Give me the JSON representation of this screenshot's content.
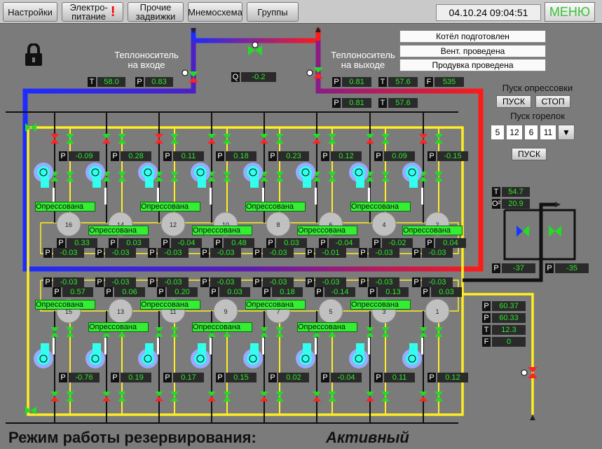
{
  "toolbar": {
    "buttons": [
      {
        "label": "Настройки"
      },
      {
        "line1": "Электро-",
        "line2": "питание",
        "alert": "!"
      },
      {
        "line1": "Прочие",
        "line2": "задвижки"
      },
      {
        "label": "Мнемосхема"
      },
      {
        "label": "Группы"
      }
    ],
    "datetime": "04.10.24 09:04:51",
    "menu_label": "МЕНЮ"
  },
  "status": [
    "Котёл подготовлен",
    "Вент. проведена",
    "Продувка проведена"
  ],
  "inlet": {
    "line1": "Теплоноситель",
    "line2": "на входе",
    "t_label": "T",
    "t": "58.0",
    "p_label": "P",
    "p": "0.83"
  },
  "outlet": {
    "line1": "Теплоноситель",
    "line2": "на выходе",
    "r1": [
      [
        "P",
        "0.81"
      ],
      [
        "T",
        "57.6"
      ],
      [
        "F",
        "535"
      ]
    ],
    "r2": [
      [
        "P",
        "0.81"
      ],
      [
        "T",
        "57.6"
      ]
    ]
  },
  "flow": {
    "label": "Q",
    "value": "-0.2"
  },
  "pressure_test": {
    "title": "Пуск опрессовки",
    "start": "ПУСК",
    "stop": "СТОП"
  },
  "burner_start": {
    "title": "Пуск горелок",
    "numbers": [
      "5",
      "12",
      "6",
      "11"
    ],
    "start": "ПУСК"
  },
  "flue": {
    "t_label": "T",
    "t": "54.7",
    "o2_label": "O²",
    "o2": "20.9",
    "p1_label": "P",
    "p1": "-37",
    "p2_label": "P",
    "p2": "-35"
  },
  "side_readings": [
    [
      "P",
      "60.37"
    ],
    [
      "P",
      "60.33"
    ],
    [
      "T",
      "12.3"
    ],
    [
      "F",
      "0"
    ]
  ],
  "pressed_label": "Опрессована",
  "upper": {
    "top_p": [
      "-0.09",
      "0.28",
      "0.11",
      "0.18",
      "0.23",
      "0.12",
      "0.09",
      "-0.15"
    ],
    "mid_p": [
      "0.33",
      "0.03",
      "-0.04",
      "0.48",
      "0.03",
      "-0.04",
      "-0.02",
      "0.04"
    ],
    "bot_p": [
      "-0.03",
      "-0.03",
      "-0.03",
      "-0.03",
      "-0.03",
      "-0.01",
      "-0.03",
      "-0.03"
    ],
    "burners": [
      "16",
      "14",
      "12",
      "10",
      "8",
      "6",
      "4",
      "2"
    ]
  },
  "lower": {
    "top_p": [
      "-0.03",
      "-0.03",
      "-0.03",
      "-0.03",
      "-0.03",
      "-0.03",
      "-0.03",
      "-0.03"
    ],
    "mid_p": [
      "0.57",
      "0.06",
      "0.20",
      "0.03",
      "0.18",
      "-0.14",
      "0.13",
      "0.03"
    ],
    "bot_p": [
      "-0.76",
      "0.19",
      "0.17",
      "0.15",
      "0.02",
      "-0.04",
      "0.11",
      "0.12"
    ],
    "burners": [
      "15",
      "13",
      "11",
      "9",
      "7",
      "5",
      "3",
      "1"
    ]
  },
  "mode": {
    "label": "Режим работы резервирования:",
    "value": "Активный"
  },
  "colors": {
    "background": "#7b7b7b",
    "value_green": "#2ee82e",
    "pressed_green": "#33ee33",
    "hot": "#ff1a1a",
    "cold": "#1438ff",
    "yellow": "#ffee22"
  }
}
